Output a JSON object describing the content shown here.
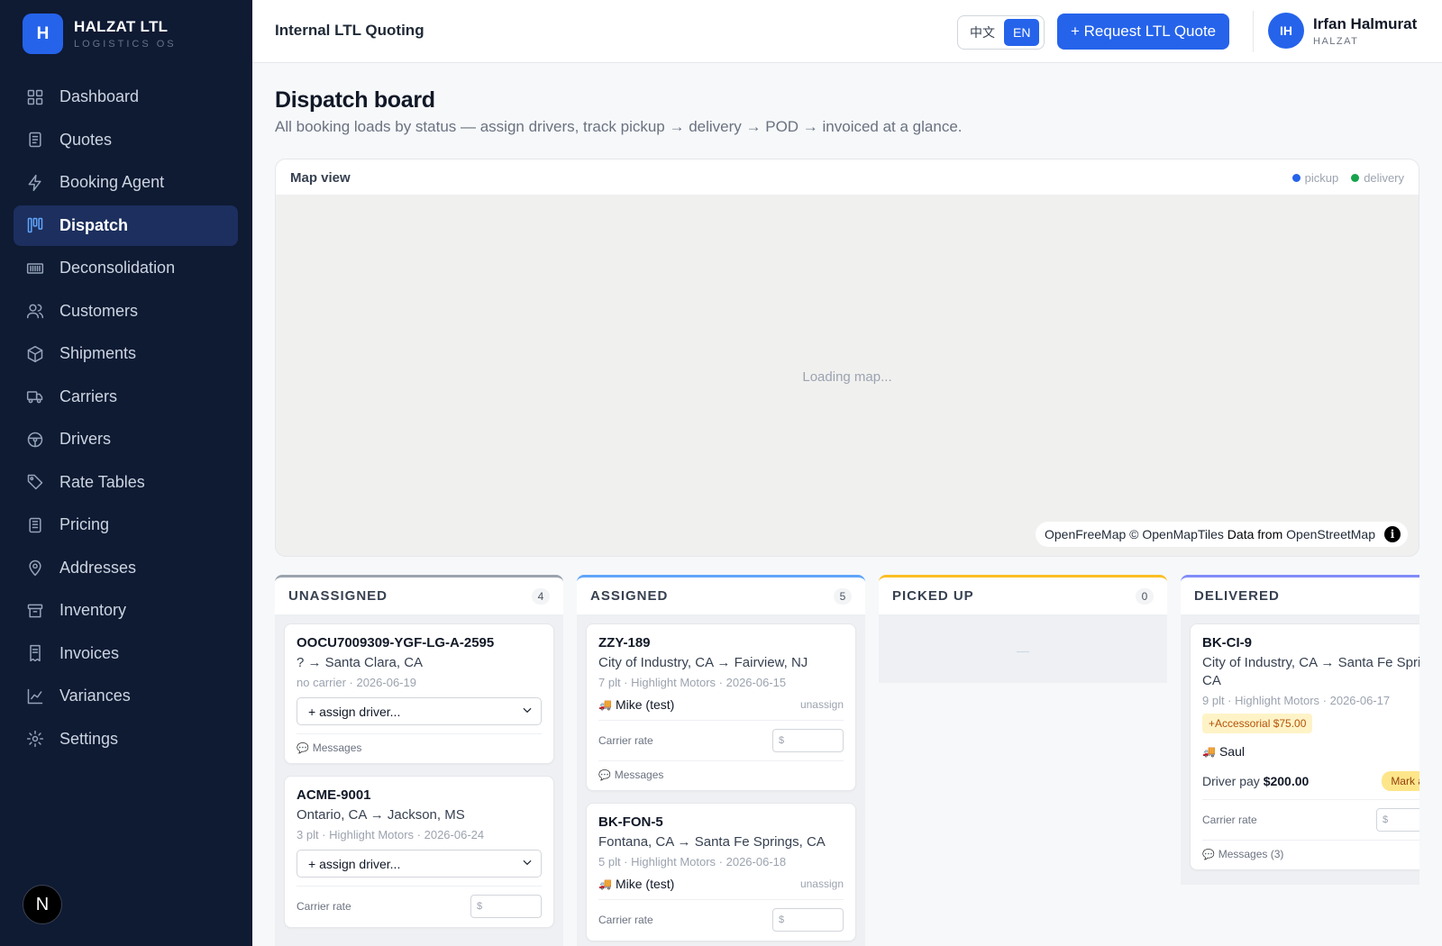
{
  "brand": {
    "logo_letter": "H",
    "name": "HALZAT LTL",
    "subtitle": "LOGISTICS OS"
  },
  "sidebar": {
    "items": [
      {
        "label": "Dashboard",
        "icon": "grid-icon"
      },
      {
        "label": "Quotes",
        "icon": "document-icon"
      },
      {
        "label": "Booking Agent",
        "icon": "lightning-icon"
      },
      {
        "label": "Dispatch",
        "icon": "kanban-icon",
        "active": true
      },
      {
        "label": "Deconsolidation",
        "icon": "barcode-icon"
      },
      {
        "label": "Customers",
        "icon": "users-icon"
      },
      {
        "label": "Shipments",
        "icon": "box-icon"
      },
      {
        "label": "Carriers",
        "icon": "truck-icon"
      },
      {
        "label": "Drivers",
        "icon": "steering-wheel-icon"
      },
      {
        "label": "Rate Tables",
        "icon": "tag-icon"
      },
      {
        "label": "Pricing",
        "icon": "sheet-icon"
      },
      {
        "label": "Addresses",
        "icon": "pin-icon"
      },
      {
        "label": "Inventory",
        "icon": "archive-icon"
      },
      {
        "label": "Invoices",
        "icon": "receipt-icon"
      },
      {
        "label": "Variances",
        "icon": "chart-line-icon"
      },
      {
        "label": "Settings",
        "icon": "gear-icon"
      }
    ],
    "footer_badge": "N"
  },
  "header": {
    "title": "Internal LTL Quoting",
    "lang_options": [
      "中文",
      "EN"
    ],
    "lang_selected": "EN",
    "request_button": "+ Request LTL Quote",
    "user": {
      "initials": "IH",
      "name": "Irfan Halmurat",
      "org": "HALZAT"
    }
  },
  "page": {
    "title": "Dispatch board",
    "subtitle": "All booking loads by status — assign drivers, track pickup → delivery → POD → invoiced at a glance."
  },
  "map": {
    "title": "Map view",
    "legend": [
      {
        "label": "pickup",
        "color": "#2563eb"
      },
      {
        "label": "delivery",
        "color": "#16a34a"
      }
    ],
    "loading_text": "Loading map...",
    "attribution": {
      "p1": "OpenFreeMap",
      "p2": "© OpenMapTiles",
      "p3": "Data from",
      "p4": "OpenStreetMap",
      "info": "i"
    }
  },
  "columns": [
    {
      "name": "UNASSIGNED",
      "count": "4",
      "accent": "#9ca3af",
      "cards": [
        {
          "id": "OOCU7009309-YGF-LG-A-2595",
          "route": "? → Santa Clara, CA",
          "meta": "no carrier · 2026-06-19",
          "select": "+ assign driver...",
          "messages": "Messages"
        },
        {
          "id": "ACME-9001",
          "route": "Ontario, CA → Jackson, MS",
          "meta": "3 plt · Highlight Motors · 2026-06-24",
          "select": "+ assign driver...",
          "rate_label": "Carrier rate",
          "rate_placeholder": "$"
        }
      ]
    },
    {
      "name": "ASSIGNED",
      "count": "5",
      "accent": "#60a5fa",
      "cards": [
        {
          "id": "ZZY-189",
          "route": "City of Industry, CA → Fairview, NJ",
          "meta": "7 plt · Highlight Motors · 2026-06-15",
          "driver": "Mike (test)",
          "unassign": "unassign",
          "rate_label": "Carrier rate",
          "rate_placeholder": "$",
          "messages": "Messages"
        },
        {
          "id": "BK-FON-5",
          "route": "Fontana, CA → Santa Fe Springs, CA",
          "meta": "5 plt · Highlight Motors · 2026-06-18",
          "driver": "Mike (test)",
          "unassign": "unassign",
          "rate_label": "Carrier rate",
          "rate_placeholder": "$"
        }
      ]
    },
    {
      "name": "PICKED UP",
      "count": "0",
      "accent": "#fbbf24",
      "empty_text": "—"
    },
    {
      "name": "DELIVERED",
      "accent": "#818cf8",
      "cards": [
        {
          "id": "BK-CI-9",
          "route": "City of Industry, CA → Santa Fe Springs, CA",
          "meta": "9 plt · Highlight Motors · 2026-06-17",
          "accessorial": "+Accessorial $75.00",
          "driver": "Saul",
          "pay_label": "Driver pay",
          "pay_value": "$200.00",
          "mark_button": "Mark as p",
          "rate_label": "Carrier rate",
          "rate_placeholder": "$",
          "messages": "Messages (3)"
        }
      ]
    }
  ]
}
